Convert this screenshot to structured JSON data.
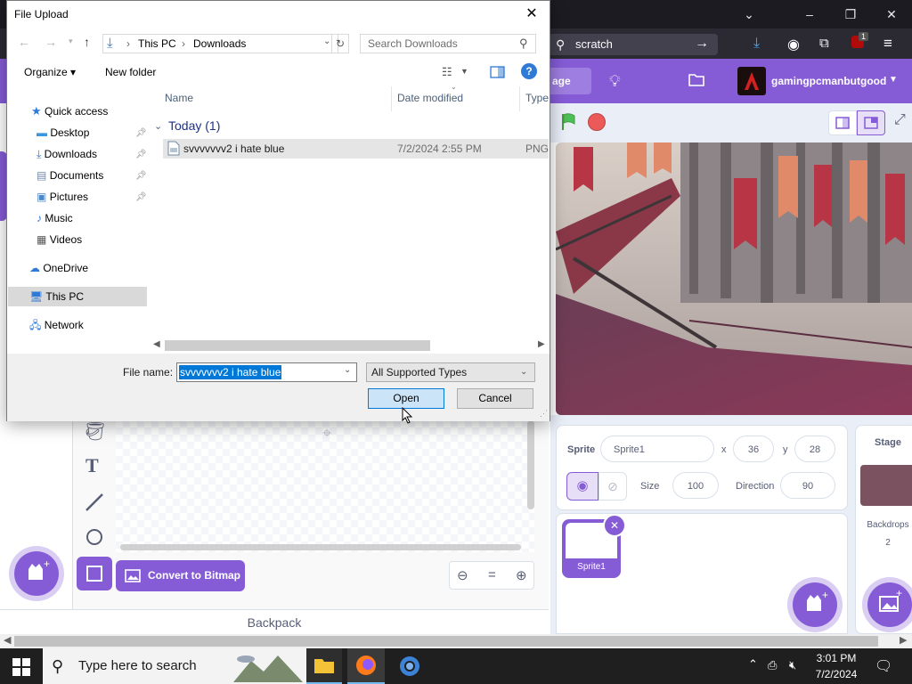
{
  "browser": {
    "url_text": "scratch",
    "addon_badge": "1",
    "window_controls": [
      "minimize-icon",
      "restore-icon",
      "close-icon"
    ]
  },
  "scratch": {
    "menu_partial": "age",
    "username": "gamingpcmanbutgood",
    "convert_button": "Convert to Bitmap",
    "backpack": "Backpack",
    "sprite_label": "Sprite",
    "sprite_name": "Sprite1",
    "x_label": "x",
    "x_value": "36",
    "y_label": "y",
    "y_value": "28",
    "size_label": "Size",
    "size_value": "100",
    "direction_label": "Direction",
    "direction_value": "90",
    "sprite_tile": "Sprite1",
    "stage_label": "Stage",
    "backdrops_label": "Backdrops",
    "backdrops_count": "2",
    "accent_color": "#855cd6"
  },
  "dialog": {
    "title": "File Upload",
    "breadcrumb": [
      "This PC",
      "Downloads"
    ],
    "search_placeholder": "Search Downloads",
    "organize": "Organize",
    "new_folder": "New folder",
    "nav": {
      "quick_access": "Quick access",
      "items": [
        "Desktop",
        "Downloads",
        "Documents",
        "Pictures",
        "Music",
        "Videos"
      ],
      "onedrive": "OneDrive",
      "this_pc": "This PC",
      "network": "Network"
    },
    "columns": {
      "name": "Name",
      "date": "Date modified",
      "type": "Type"
    },
    "group": "Today (1)",
    "file": {
      "name": "svvvvvvv2 i hate blue",
      "date": "7/2/2024 2:55 PM",
      "type": "PNG"
    },
    "filename_label": "File name:",
    "filename_value": "svvvvvvv2 i hate blue",
    "filetype": "All Supported Types",
    "open": "Open",
    "cancel": "Cancel"
  },
  "taskbar": {
    "search_placeholder": "Type here to search",
    "time": "3:01 PM",
    "date": "7/2/2024"
  }
}
